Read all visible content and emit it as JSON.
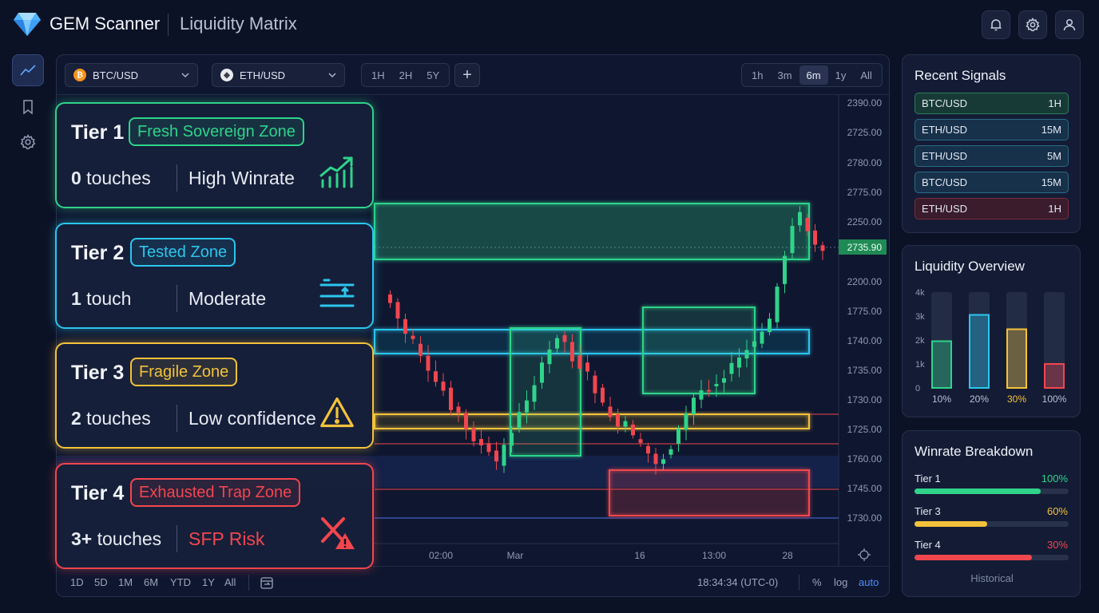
{
  "app": {
    "name": "GEM Scanner",
    "page": "Liquidity Matrix"
  },
  "header": {
    "icons": [
      "bell-icon",
      "gear-icon",
      "user-icon"
    ]
  },
  "rail": {
    "icons": [
      "chart-line-icon",
      "bookmark-icon",
      "gear-icon"
    ]
  },
  "toolbar": {
    "symbols": [
      {
        "label": "BTC/USD",
        "coin": "bitcoin-icon",
        "color": "#f7931a"
      },
      {
        "label": "ETH/USD",
        "coin": "ethereum-icon",
        "color": "#c8cbd4"
      }
    ],
    "intervals": [
      "1H",
      "2H",
      "5Y"
    ],
    "add_label": "+",
    "ranges": [
      "1h",
      "3m",
      "6m",
      "1y",
      "All"
    ],
    "active_range": "6m"
  },
  "price_axis": {
    "labels": [
      "2390.00",
      "2725.00",
      "2780.00",
      "2775.00",
      "2250.00",
      "2200.00",
      "1775.00",
      "1740.00",
      "1735.00",
      "1730.00",
      "1725.00",
      "1760.00",
      "1745.00",
      "1730.00"
    ],
    "current_price": "2735.90",
    "current_color": "#1f8a55"
  },
  "time_axis": {
    "labels": [
      "02:00",
      "Mar",
      "16",
      "13:00",
      "28"
    ]
  },
  "bottom_bar": {
    "ranges": [
      "1D",
      "5D",
      "1M",
      "6M",
      "YTD",
      "1Y",
      "All"
    ],
    "clock": "18:34:34 (UTC-0)",
    "options": [
      "%",
      "log",
      "auto"
    ]
  },
  "tiers": [
    {
      "title": "Tier 1",
      "badge": "Fresh Sovereign Zone",
      "count_num": "0",
      "count_word": " touches",
      "desc": "High Winrate",
      "icon": "trend-up-bars-icon",
      "color": "#2fd38a"
    },
    {
      "title": "Tier 2",
      "badge": "Tested Zone",
      "count_num": "1",
      "count_word": " touch",
      "desc": "Moderate",
      "icon": "price-level-icon",
      "color": "#2cc6ee"
    },
    {
      "title": "Tier 3",
      "badge": "Fragile Zone",
      "count_num": "2",
      "count_word": " touches",
      "desc": "Low confidence",
      "icon": "warning-icon",
      "color": "#f4c23a"
    },
    {
      "title": "Tier 4",
      "badge": "Exhausted Trap Zone",
      "count_num": "3+",
      "count_word": " touches",
      "desc": "SFP Risk",
      "icon": "x-warning-icon",
      "color": "#f2464e"
    }
  ],
  "recent_signals": {
    "title": "Recent Signals",
    "items": [
      {
        "pair": "BTC/USD",
        "tf": "1H",
        "color": "#2fd38a"
      },
      {
        "pair": "ETH/USD",
        "tf": "15M",
        "color": "#2cc6ee"
      },
      {
        "pair": "ETH/USD",
        "tf": "5M",
        "color": "#2cc6ee"
      },
      {
        "pair": "BTC/USD",
        "tf": "15M",
        "color": "#2cc6ee"
      },
      {
        "pair": "ETH/USD",
        "tf": "1H",
        "color": "#f2464e"
      }
    ]
  },
  "liquidity_overview": {
    "title": "Liquidity Overview",
    "chart_data": {
      "type": "bar",
      "categories": [
        "10%",
        "20%",
        "30%",
        "100%"
      ],
      "values": [
        1.95,
        3.05,
        2.45,
        1.0
      ],
      "colors": [
        "#2fd38a",
        "#2cc6ee",
        "#f4c23a",
        "#f2464e"
      ],
      "ylim": [
        0,
        4
      ],
      "yticks": [
        "4k",
        "3k",
        "2k",
        "1k",
        "0"
      ],
      "title": "Liquidity Overview"
    }
  },
  "winrate": {
    "title": "Winrate Breakdown",
    "items": [
      {
        "label": "Tier 1",
        "value": "100%",
        "fraction": 0.82,
        "color": "#2fd38a"
      },
      {
        "label": "Tier 3",
        "value": "60%",
        "fraction": 0.47,
        "color": "#f4c23a"
      },
      {
        "label": "Tier 4",
        "value": "30%",
        "fraction": 0.76,
        "color": "#f2464e"
      }
    ],
    "footer": "Historical"
  }
}
